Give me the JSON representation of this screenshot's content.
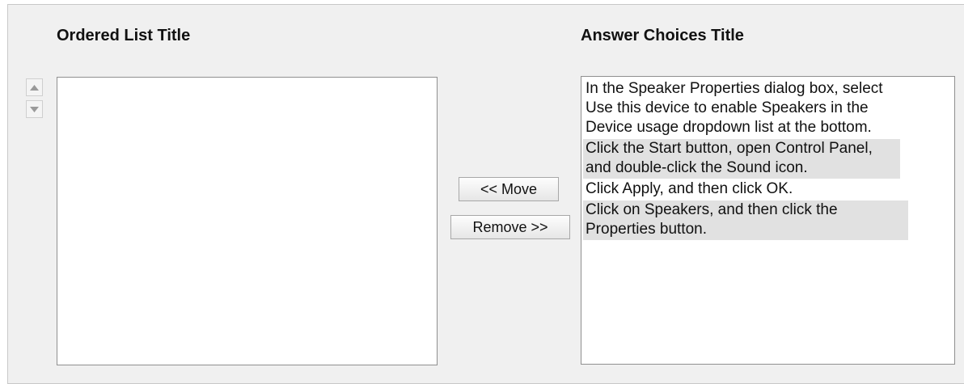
{
  "ordered_list": {
    "title": "Ordered List Title",
    "items": []
  },
  "controls": {
    "up_icon": "triangle-up",
    "down_icon": "triangle-down",
    "move_label": "<< Move",
    "remove_label": "Remove >>"
  },
  "answer_choices": {
    "title": "Answer Choices Title",
    "items": [
      "In the Speaker Properties dialog box, select Use this device to enable Speakers in the Device usage dropdown list at the bottom.",
      "Click the Start button, open Control Panel, and double-click the Sound icon.",
      "Click Apply, and then click OK.",
      "Click on Speakers, and then click the Properties button."
    ]
  },
  "colors": {
    "panel_background": "#f0f0f0",
    "list_border": "#8f8f8f",
    "row_shade": "#e1e1e1"
  }
}
